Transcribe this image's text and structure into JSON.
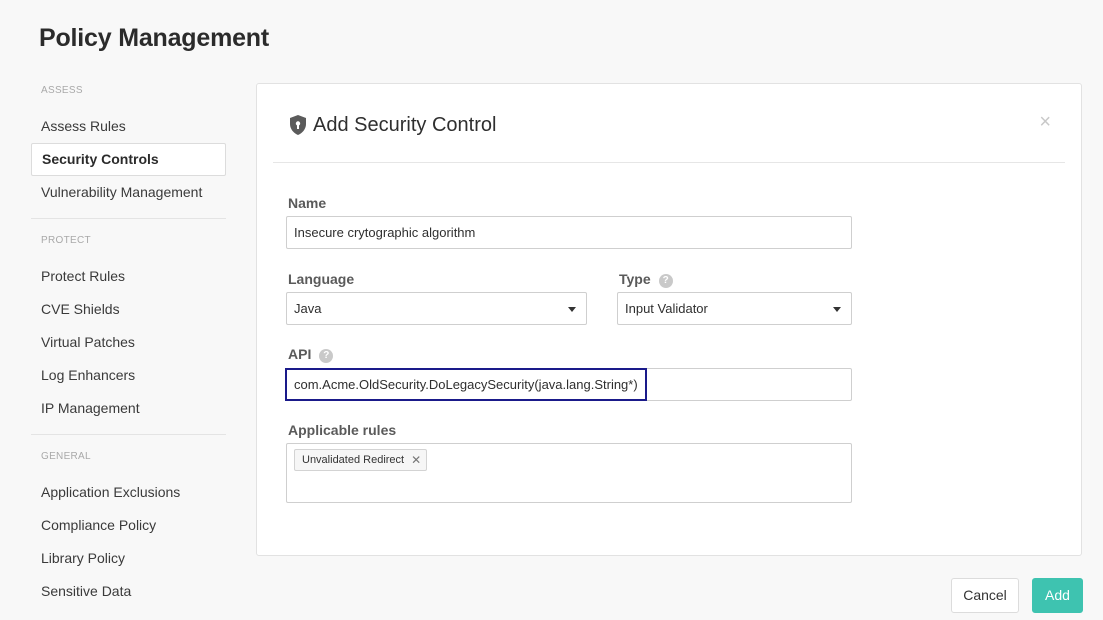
{
  "page": {
    "title": "Policy Management"
  },
  "sidebar": {
    "sections": [
      {
        "header": "ASSESS",
        "items": [
          {
            "label": "Assess Rules",
            "active": false
          },
          {
            "label": "Security Controls",
            "active": true
          },
          {
            "label": "Vulnerability Management",
            "active": false
          }
        ]
      },
      {
        "header": "PROTECT",
        "items": [
          {
            "label": "Protect Rules",
            "active": false
          },
          {
            "label": "CVE Shields",
            "active": false
          },
          {
            "label": "Virtual Patches",
            "active": false
          },
          {
            "label": "Log Enhancers",
            "active": false
          },
          {
            "label": "IP Management",
            "active": false
          }
        ]
      },
      {
        "header": "GENERAL",
        "items": [
          {
            "label": "Application Exclusions",
            "active": false
          },
          {
            "label": "Compliance Policy",
            "active": false
          },
          {
            "label": "Library Policy",
            "active": false
          },
          {
            "label": "Sensitive Data",
            "active": false
          }
        ]
      }
    ]
  },
  "modal": {
    "title": "Add Security Control",
    "close_glyph": "×",
    "header_icon": "shield-icon",
    "fields": {
      "name": {
        "label": "Name",
        "value": "Insecure crytographic algorithm"
      },
      "language": {
        "label": "Language",
        "value": "Java"
      },
      "type": {
        "label": "Type",
        "value": "Input Validator",
        "help": "?"
      },
      "api": {
        "label": "API",
        "value": "com.Acme.OldSecurity.DoLegacySecurity(java.lang.String*)",
        "help": "?"
      },
      "applicable_rules": {
        "label": "Applicable rules",
        "tags": [
          {
            "label": "Unvalidated Redirect",
            "remove_glyph": "✕"
          }
        ]
      }
    }
  },
  "footer": {
    "cancel_label": "Cancel",
    "add_label": "Add"
  },
  "colors": {
    "accent": "#3ec3b0",
    "focus_border": "#1a1a8a",
    "background": "#f8f8f8"
  }
}
